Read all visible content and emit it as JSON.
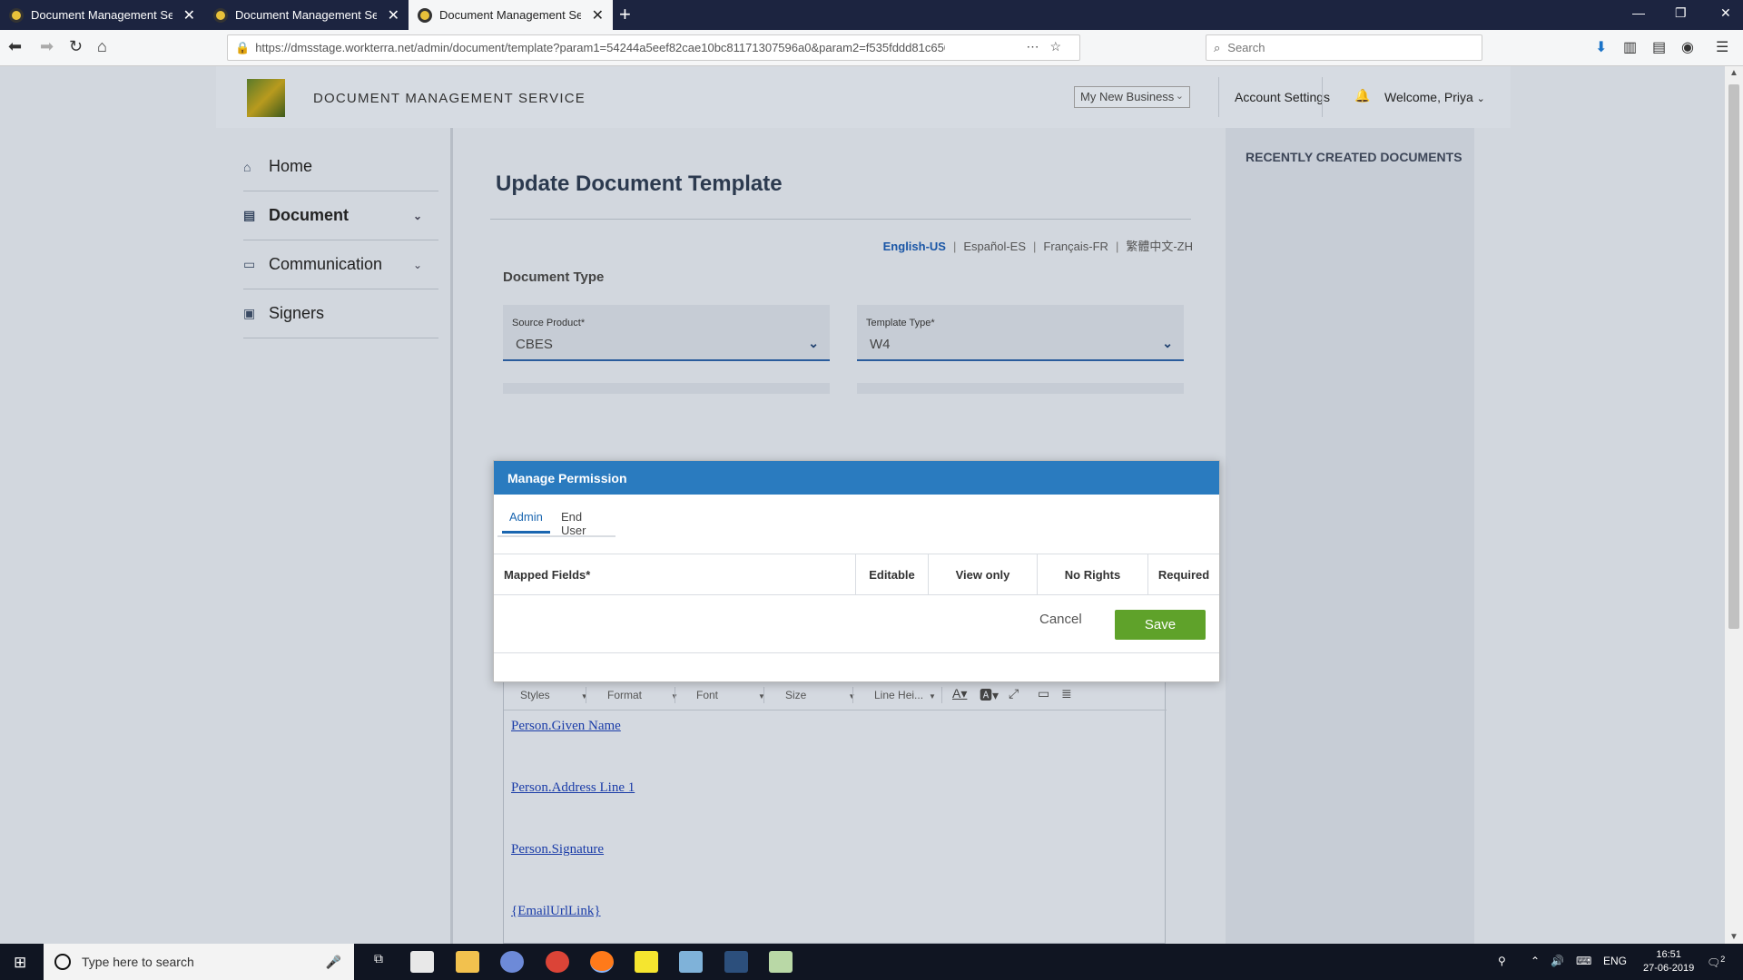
{
  "browser": {
    "tabs": [
      {
        "title": "Document Management Servic",
        "active": false
      },
      {
        "title": "Document Management Servic",
        "active": false
      },
      {
        "title": "Document Management Servic",
        "active": true
      }
    ],
    "url": "https://dmsstage.workterra.net/admin/document/template?param1=54244a5eef82cae10bc81171307596a0&param2=f535fddd81c6504e18c",
    "search_placeholder": "Search"
  },
  "header": {
    "app_title": "DOCUMENT MANAGEMENT SERVICE",
    "business_select": "My New Business",
    "account_settings": "Account Settings",
    "welcome": "Welcome, Priya"
  },
  "sidebar": {
    "items": [
      {
        "label": "Home",
        "icon": "home-icon"
      },
      {
        "label": "Document",
        "icon": "document-icon"
      },
      {
        "label": "Communication",
        "icon": "chat-icon"
      },
      {
        "label": "Signers",
        "icon": "signers-icon"
      }
    ]
  },
  "main": {
    "heading": "Update Document Template",
    "languages": [
      "English-US",
      "Español-ES",
      "Français-FR",
      "繁體中文-ZH"
    ],
    "selected_language": "English-US",
    "doc_type_label": "Document Type",
    "source_product": {
      "label": "Source Product*",
      "value": "CBES"
    },
    "template_type": {
      "label": "Template Type*",
      "value": "W4"
    },
    "editor": {
      "toolbar": [
        "Styles",
        "Format",
        "Font",
        "Size",
        "Line Hei..."
      ],
      "links": [
        "Person.Given Name",
        "Person.Address Line 1",
        "Person.Signature",
        "{EmailUrlLink}"
      ]
    }
  },
  "recent": {
    "title": "RECENTLY CREATED DOCUMENTS"
  },
  "modal": {
    "title": "Manage Permission",
    "tabs": [
      "Admin",
      "End User"
    ],
    "active_tab": "Admin",
    "columns": [
      "Mapped Fields*",
      "Editable",
      "View only",
      "No Rights",
      "Required"
    ],
    "cancel": "Cancel",
    "save": "Save"
  },
  "taskbar": {
    "search_placeholder": "Type here to search",
    "language": "ENG",
    "time": "16:51",
    "date": "27-06-2019",
    "notifications": "2"
  },
  "colors": {
    "modal_header": "#2a7bbf",
    "save_button": "#5fa22a",
    "accent_link": "#1a56a6"
  }
}
